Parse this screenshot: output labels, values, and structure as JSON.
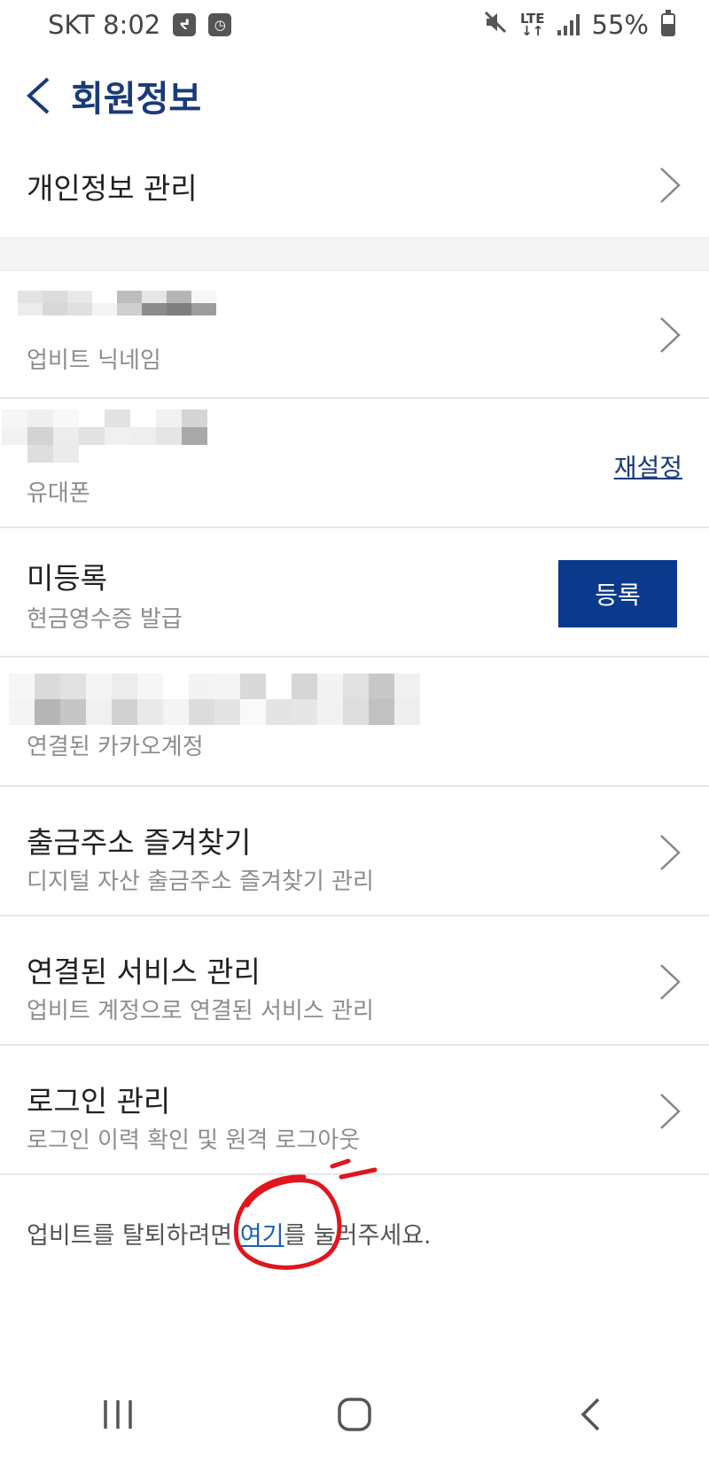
{
  "status_bar": {
    "carrier_time": "SKT 8:02",
    "network": "LTE",
    "battery": "55%",
    "battery_level": 55,
    "icons": [
      "notification-icon",
      "clock-icon",
      "mute-icon",
      "lte-icon",
      "signal-icon",
      "battery-icon"
    ]
  },
  "header": {
    "title": "회원정보"
  },
  "menu": {
    "personal_info": "개인정보 관리",
    "nickname_label": "업비트 닉네임",
    "phone_label": "유대폰",
    "phone_action": "재설정",
    "receipt_status": "미등록",
    "receipt_label": "현금영수증 발급",
    "receipt_action": "등록",
    "kakao_label": "연결된 카카오계정",
    "address_title": "출금주소 즐겨찾기",
    "address_sub": "디지털 자산 출금주소 즐겨찾기 관리",
    "services_title": "연결된 서비스 관리",
    "services_sub": "업비트 계정으로 연결된 서비스 관리",
    "login_title": "로그인 관리",
    "login_sub": "로그인 이력 확인 및 원격 로그아웃"
  },
  "withdraw": {
    "before": "업비트를 탈퇴하려면 ",
    "link": "여기",
    "after": "를 눌러주세요."
  },
  "colors": {
    "accent": "#1a3a7a",
    "button": "#0b3a8c",
    "link": "#1a5fb4",
    "annotation": "#e0161d"
  }
}
